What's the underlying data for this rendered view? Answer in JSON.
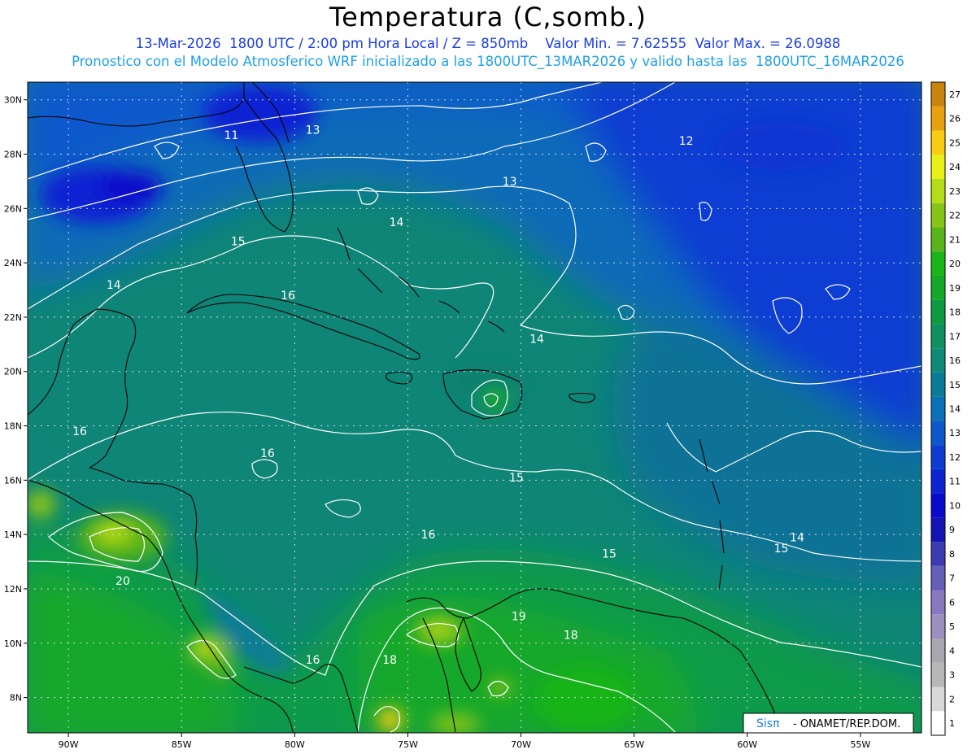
{
  "header": {
    "title": "Temperatura (C,somb.)",
    "line1": "13-Mar-2026  1800 UTC / 2:00 pm Hora Local / Z = 850mb    Valor Min. = 7.62555  Valor Max. = 26.0988",
    "line2": "Pronostico con el Modelo Atmosferico WRF inicializado a las 1800UTC_13MAR2026 y valido hasta las  1800UTC_16MAR2026"
  },
  "map": {
    "lat_ticks": [
      "30N",
      "28N",
      "26N",
      "24N",
      "22N",
      "20N",
      "18N",
      "16N",
      "14N",
      "12N",
      "10N",
      "8N"
    ],
    "lon_ticks": [
      "90W",
      "85W",
      "80W",
      "75W",
      "70W",
      "65W",
      "60W",
      "55W"
    ],
    "lat_values": [
      30,
      28,
      26,
      24,
      22,
      20,
      18,
      16,
      14,
      12,
      10,
      8
    ],
    "lon_values": [
      -90,
      -85,
      -80,
      -75,
      -70,
      -65,
      -60,
      -55
    ],
    "contour_labels": [
      {
        "text": "13",
        "lon": -79.2,
        "lat": 28.9
      },
      {
        "text": "11",
        "lon": -82.8,
        "lat": 28.7
      },
      {
        "text": "12",
        "lon": -62.7,
        "lat": 28.5
      },
      {
        "text": "13",
        "lon": -70.5,
        "lat": 27.0
      },
      {
        "text": "14",
        "lon": -75.5,
        "lat": 25.5
      },
      {
        "text": "15",
        "lon": -82.5,
        "lat": 24.8
      },
      {
        "text": "14",
        "lon": -88.0,
        "lat": 23.2
      },
      {
        "text": "16",
        "lon": -80.3,
        "lat": 22.8
      },
      {
        "text": "14",
        "lon": -69.3,
        "lat": 21.2
      },
      {
        "text": "16",
        "lon": -89.5,
        "lat": 17.8
      },
      {
        "text": "16",
        "lon": -81.2,
        "lat": 17.0
      },
      {
        "text": "15",
        "lon": -70.2,
        "lat": 16.1
      },
      {
        "text": "16",
        "lon": -74.1,
        "lat": 14.0
      },
      {
        "text": "14",
        "lon": -57.8,
        "lat": 13.9
      },
      {
        "text": "15",
        "lon": -66.1,
        "lat": 13.3
      },
      {
        "text": "15",
        "lon": -58.5,
        "lat": 13.5
      },
      {
        "text": "20",
        "lon": -87.6,
        "lat": 12.3
      },
      {
        "text": "19",
        "lon": -70.1,
        "lat": 11.0
      },
      {
        "text": "18",
        "lon": -67.8,
        "lat": 10.3
      },
      {
        "text": "16",
        "lon": -79.2,
        "lat": 9.4
      },
      {
        "text": "18",
        "lon": -75.8,
        "lat": 9.4
      }
    ]
  },
  "colorbar": {
    "labels": [
      "1",
      "2",
      "3",
      "4",
      "5",
      "6",
      "7",
      "8",
      "9",
      "10",
      "11",
      "12",
      "13",
      "14",
      "15",
      "16",
      "17",
      "18",
      "19",
      "20",
      "21",
      "22",
      "23",
      "24",
      "25",
      "26",
      "27"
    ],
    "colors": [
      "#ffffff",
      "#d8d8d8",
      "#b8b8b8",
      "#a8a8b0",
      "#9c90c0",
      "#8878c0",
      "#6460b8",
      "#3c3cb0",
      "#1414b4",
      "#0a0aca",
      "#0c24d2",
      "#0c3cd2",
      "#0a58cc",
      "#0a70b8",
      "#0c7c96",
      "#0e8a78",
      "#0e9060",
      "#0e9a40",
      "#14a828",
      "#18b418",
      "#58b418",
      "#88c418",
      "#b4dc18",
      "#e8f018",
      "#f8cc10",
      "#e8a010",
      "#c8840c"
    ]
  },
  "credit": {
    "brand": "Sisπ",
    "text": "- ONAMET/REP.DOM."
  }
}
